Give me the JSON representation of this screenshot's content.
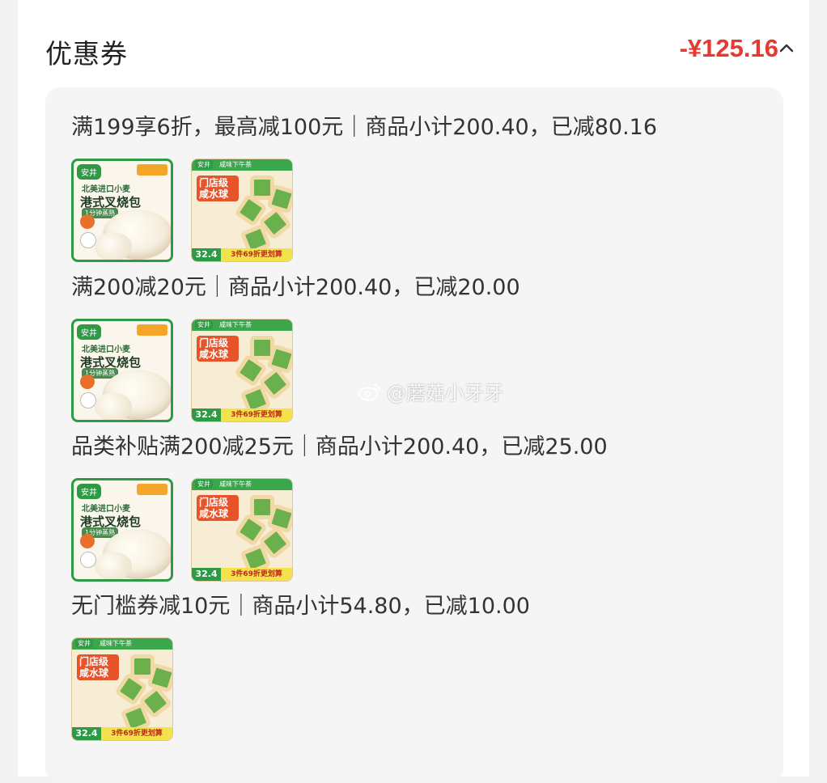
{
  "header": {
    "title": "优惠券",
    "total_discount": "-¥125.16",
    "collapse_icon": "chevron-up-icon"
  },
  "coupons": [
    {
      "summary": "满199享6折，最高减100元｜商品小计200.40，已减80.16",
      "products": [
        {
          "name": "bun-product",
          "brand": "安井",
          "tag": "北美进口小麦",
          "title": "港式叉烧包",
          "sub": "1分钟蒸熟"
        },
        {
          "name": "salty-ball-product",
          "brand": "安井",
          "top": "咸味下午茶",
          "title": "门店级咸水球",
          "price": "32.4",
          "promo": "3件69折更划算"
        }
      ]
    },
    {
      "summary": "满200减20元｜商品小计200.40，已减20.00",
      "products": [
        {
          "name": "bun-product",
          "brand": "安井",
          "tag": "北美进口小麦",
          "title": "港式叉烧包",
          "sub": "1分钟蒸熟"
        },
        {
          "name": "salty-ball-product",
          "brand": "安井",
          "top": "咸味下午茶",
          "title": "门店级咸水球",
          "price": "32.4",
          "promo": "3件69折更划算"
        }
      ]
    },
    {
      "summary": "品类补贴满200减25元｜商品小计200.40，已减25.00",
      "products": [
        {
          "name": "bun-product",
          "brand": "安井",
          "tag": "北美进口小麦",
          "title": "港式叉烧包",
          "sub": "1分钟蒸熟"
        },
        {
          "name": "salty-ball-product",
          "brand": "安井",
          "top": "咸味下午茶",
          "title": "门店级咸水球",
          "price": "32.4",
          "promo": "3件69折更划算"
        }
      ]
    },
    {
      "summary": "无门槛券减10元｜商品小计54.80，已减10.00",
      "products": [
        {
          "name": "salty-ball-product",
          "brand": "安井",
          "top": "咸味下午茶",
          "title": "门店级咸水球",
          "price": "32.4",
          "promo": "3件69折更划算"
        }
      ]
    }
  ],
  "watermark": {
    "text": "@蘑菇小牙牙",
    "icon": "weibo-icon"
  },
  "colors": {
    "discount_red": "#e6392f",
    "brand_green": "#2e9a46",
    "accent_orange": "#e8702a"
  }
}
